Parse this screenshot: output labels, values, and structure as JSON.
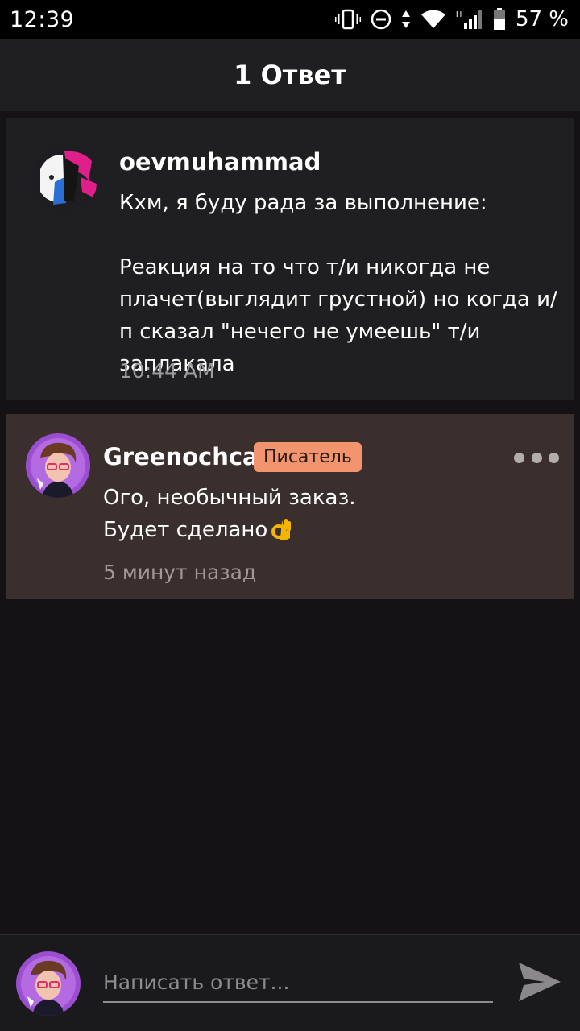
{
  "status_bar": {
    "time": "12:39",
    "battery_percent": "57 %",
    "network_type": "H",
    "icons": [
      "vibrate-icon",
      "do-not-disturb-icon",
      "data-arrows-icon",
      "wifi-icon",
      "cell-signal-icon",
      "battery-icon"
    ]
  },
  "header": {
    "title": "1 Ответ"
  },
  "post": {
    "username": "oevmuhammad",
    "body": "Кхм, я буду рада за выполнение:\n\nРеакция на то что т/и никогда не плачет(выглядит грустной) но когда и/п сказал \"нечего не умеешь\" т/и заплакала",
    "time": "10:44 AM",
    "avatar_colors": [
      "#e0208a",
      "#2a6fd6",
      "#1a1a1a",
      "#f4f4f4"
    ]
  },
  "reply": {
    "username": "Greenochca",
    "role_badge": "Писатель",
    "line1": "Ого, необычный заказ.",
    "line2": "Будет сделано",
    "emoji_icon": "ok-hand-icon",
    "time": "5 минут назад",
    "badge_color": "#f2946d",
    "avatar_colors": [
      "#9b4fd0",
      "#6b3a24",
      "#f29a8a"
    ]
  },
  "compose": {
    "placeholder": "Написать ответ...",
    "send_icon": "send-icon"
  }
}
